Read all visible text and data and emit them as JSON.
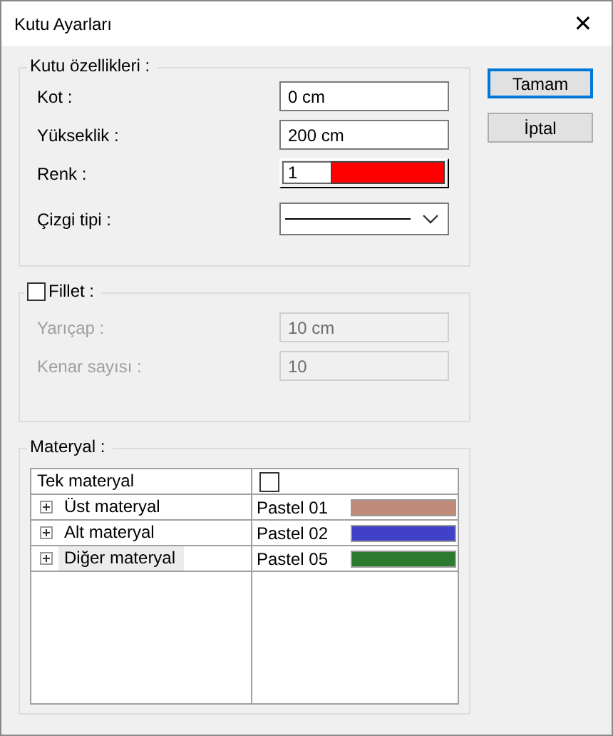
{
  "window": {
    "title": "Kutu Ayarları",
    "close": "✕"
  },
  "buttons": [
    {
      "label": "Tamam",
      "default": true
    },
    {
      "label": "İptal",
      "default": false
    }
  ],
  "box_properties": {
    "title": "Kutu özellikleri :",
    "fields": [
      {
        "kind": "text",
        "label": "Kot :",
        "value": "0 cm"
      },
      {
        "kind": "text",
        "label": "Yükseklik :",
        "value": "200 cm"
      },
      {
        "kind": "color",
        "label": "Renk :",
        "value": "1",
        "color": "#ff0000"
      },
      {
        "kind": "linetype",
        "label": "Çizgi tipi :"
      }
    ]
  },
  "fillet": {
    "title": "Fillet :",
    "checked": false,
    "fields": [
      {
        "label": "Yarıçap :",
        "value": "10 cm"
      },
      {
        "label": "Kenar sayısı :",
        "value": "10"
      }
    ]
  },
  "material": {
    "title": "Materyal :",
    "rows": [
      {
        "kind": "checkbox",
        "name": "Tek materyal",
        "checked": false
      },
      {
        "kind": "material",
        "name": "Üst materyal",
        "value": "Pastel 01",
        "color": "#c08a78",
        "selected": false
      },
      {
        "kind": "material",
        "name": "Alt materyal",
        "value": "Pastel 02",
        "color": "#4040c8",
        "selected": false
      },
      {
        "kind": "material",
        "name": "Diğer materyal",
        "value": "Pastel 05",
        "color": "#2a7a30",
        "selected": true
      }
    ]
  }
}
